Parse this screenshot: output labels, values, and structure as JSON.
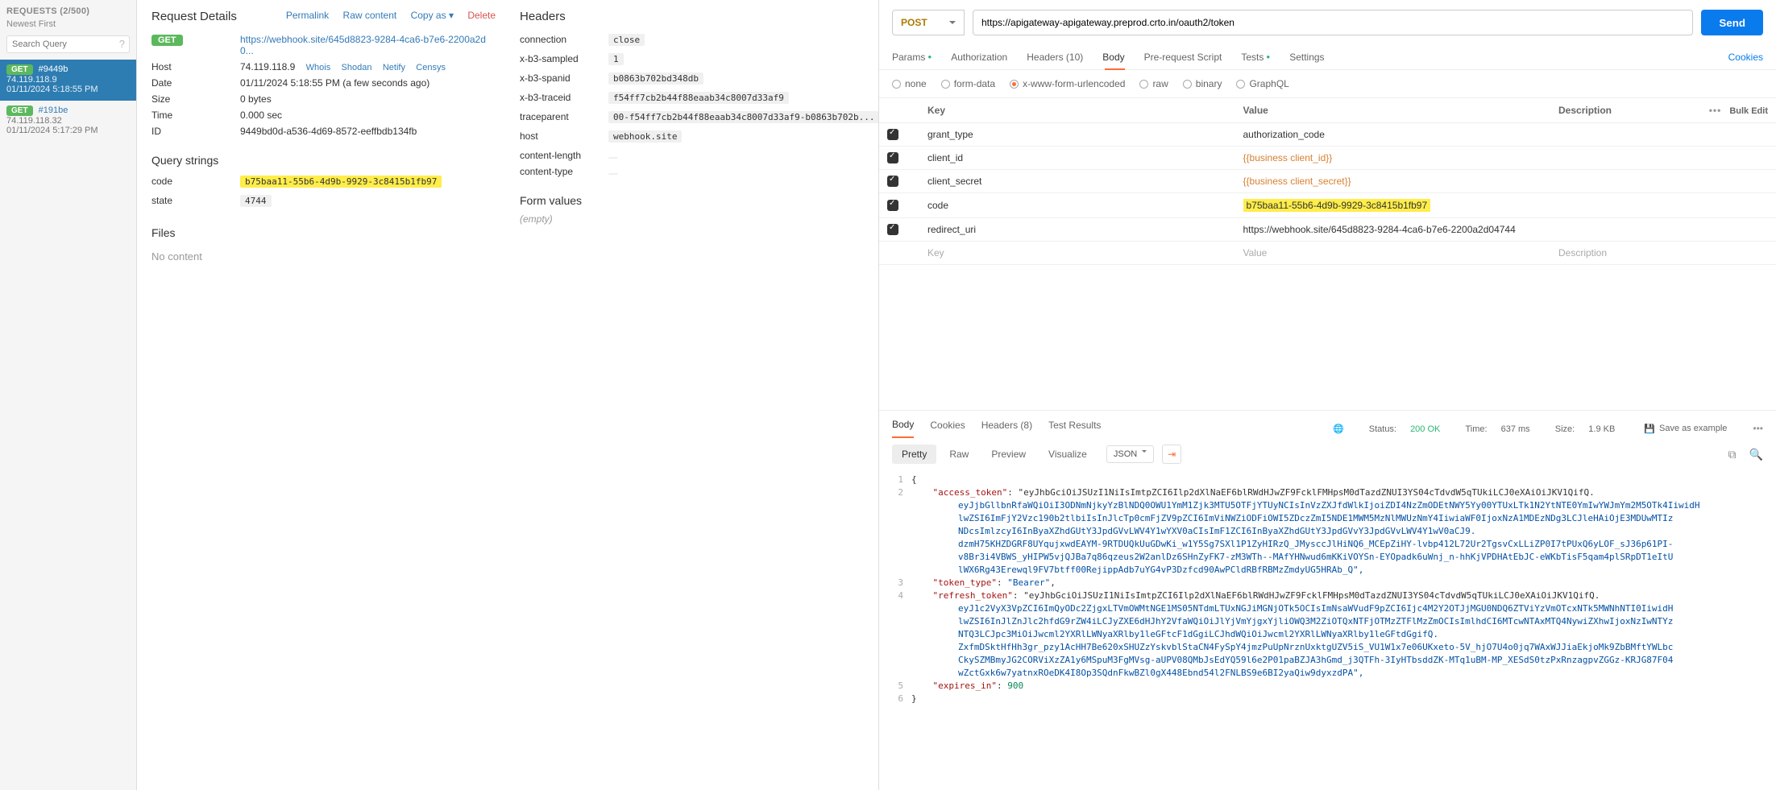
{
  "webhook": {
    "requests_header": "REQUESTS (2/500)",
    "newest_first": "Newest First",
    "search_placeholder": "Search Query",
    "items": [
      {
        "method": "GET",
        "id": "#9449b",
        "ip": "74.119.118.9",
        "time": "01/11/2024 5:18:55 PM"
      },
      {
        "method": "GET",
        "id": "#191be",
        "ip": "74.119.118.32",
        "time": "01/11/2024 5:17:29 PM"
      }
    ],
    "detail": {
      "title": "Request Details",
      "actions": {
        "permalink": "Permalink",
        "raw": "Raw content",
        "copyas": "Copy as",
        "delete": "Delete"
      },
      "method_badge": "GET",
      "url": "https://webhook.site/645d8823-9284-4ca6-b7e6-2200a2d0...",
      "host_label": "Host",
      "host": "74.119.118.9",
      "host_links": {
        "whois": "Whois",
        "shodan": "Shodan",
        "netify": "Netify",
        "censys": "Censys"
      },
      "date_label": "Date",
      "date": "01/11/2024 5:18:55 PM (a few seconds ago)",
      "size_label": "Size",
      "size": "0 bytes",
      "time_label": "Time",
      "time": "0.000 sec",
      "id_label": "ID",
      "id": "9449bd0d-a536-4d69-8572-eeffbdb134fb",
      "query_title": "Query strings",
      "query": [
        {
          "k": "code",
          "v": "b75baa11-55b6-4d9b-9929-3c8415b1fb97",
          "hl": true
        },
        {
          "k": "state",
          "v": "4744"
        }
      ],
      "files_title": "Files",
      "no_content": "No content"
    },
    "headers": {
      "title": "Headers",
      "rows": [
        {
          "k": "connection",
          "v": "close"
        },
        {
          "k": "x-b3-sampled",
          "v": "1"
        },
        {
          "k": "x-b3-spanid",
          "v": "b0863b702bd348db"
        },
        {
          "k": "x-b3-traceid",
          "v": "f54ff7cb2b44f88eaab34c8007d33af9"
        },
        {
          "k": "traceparent",
          "v": "00-f54ff7cb2b44f88eaab34c8007d33af9-b0863b702b..."
        },
        {
          "k": "host",
          "v": "webhook.site"
        },
        {
          "k": "content-length",
          "v": ""
        },
        {
          "k": "content-type",
          "v": ""
        }
      ],
      "form_title": "Form values",
      "form_empty": "(empty)"
    }
  },
  "postman": {
    "method": "POST",
    "url": "https://apigateway-apigateway.preprod.crto.in/oauth2/token",
    "send": "Send",
    "tabs": {
      "params": "Params",
      "auth": "Authorization",
      "headers": "Headers (10)",
      "body": "Body",
      "prereq": "Pre-request Script",
      "tests": "Tests",
      "settings": "Settings",
      "cookies": "Cookies"
    },
    "bodytype": {
      "none": "none",
      "formdata": "form-data",
      "xwww": "x-www-form-urlencoded",
      "raw": "raw",
      "binary": "binary",
      "graphql": "GraphQL"
    },
    "grid": {
      "hd_key": "Key",
      "hd_value": "Value",
      "hd_desc": "Description",
      "bulk": "Bulk Edit",
      "rows": [
        {
          "k": "grant_type",
          "v": "authorization_code",
          "var": false,
          "hl": false
        },
        {
          "k": "client_id",
          "v": "{{business client_id}}",
          "var": true,
          "hl": false
        },
        {
          "k": "client_secret",
          "v": "{{business client_secret}}",
          "var": true,
          "hl": false
        },
        {
          "k": "code",
          "v": "b75baa11-55b6-4d9b-9929-3c8415b1fb97",
          "var": false,
          "hl": true
        },
        {
          "k": "redirect_uri",
          "v": "https://webhook.site/645d8823-9284-4ca6-b7e6-2200a2d04744",
          "var": false,
          "hl": false
        }
      ],
      "ph_key": "Key",
      "ph_value": "Value",
      "ph_desc": "Description"
    },
    "response": {
      "tabs": {
        "body": "Body",
        "cookies": "Cookies",
        "headers": "Headers (8)",
        "tests": "Test Results"
      },
      "status_label": "Status:",
      "status": "200 OK",
      "time_label": "Time:",
      "time": "637 ms",
      "size_label": "Size:",
      "size": "1.9 KB",
      "save": "Save as example",
      "viewmodes": {
        "pretty": "Pretty",
        "raw": "Raw",
        "preview": "Preview",
        "visualize": "Visualize"
      },
      "format": "JSON",
      "json_lines": [
        "{",
        "    \"access_token\": \"eyJhbGciOiJSUzI1NiIsImtpZCI6Ilp2dXlNaEF6blRWdHJwZF9FcklFMHpsM0dTazdZNUI3YS04cTdvdW5qTUkiLCJ0eXAiOiJKV1QifQ.",
        "        eyJjbGllbnRfaWQiOiI3ODNmNjkyYzBlNDQ0OWU1YmM1Zjk3MTU5OTFjYTUyNCIsInVzZXJfdWlkIjoiZDI4NzZmODEtNWY5Yy00YTUxLTk1N2YtNTE0YmIwYWJmYm2M5OTk4IiwidH",
        "        lwZSI6ImFjY2Vzc190b2tlbiIsInJlcTp0cmFjZV9pZCI6ImViNWZiODFiOWI5ZDczZmI5NDE1MWM5MzNlMWUzNmY4IiwiaWF0IjoxNzA1MDEzNDg3LCJleHAiOjE3MDUwMTIz",
        "        NDcsImlzcyI6InByaXZhdGUtY3JpdGVvLWV4Y1wYXV0aCIsImF1ZCI6InByaXZhdGUtY3JpdGVvY3JpdGVvLWV4Y1wV0aCJ9.",
        "        dzmH75KHZDGRF8UYqujxwdEAYM-9RTDUQkUuGDwKi_w1Y5Sg7SXl1P1ZyHIRzQ_JMysccJlHiNQ6_MCEpZiHY-lvbp412L72Ur2TgsvCxLLiZP0I7tPUxQ6yLOF_sJ36p61PI-",
        "        v8Br3i4VBWS_yHIPW5vjQJBa7q86qzeus2W2anlDz6SHnZyFK7-zM3WTh--MAfYHNwud6mKKiVOYSn-EYOpadk6uWnj_n-hhKjVPDHAtEbJC-eWKbTisF5qam4plSRpDT1eItU",
        "        lWX6Rg43Erewql9FV7btff00RejippAdb7uYG4vP3Dzfcd90AwPCldRBfRBMzZmdyUG5HRAb_Q\",",
        "    \"token_type\": \"Bearer\",",
        "    \"refresh_token\": \"eyJhbGciOiJSUzI1NiIsImtpZCI6Ilp2dXlNaEF6blRWdHJwZF9FcklFMHpsM0dTazdZNUI3YS04cTdvdW5qTUkiLCJ0eXAiOiJKV1QifQ.",
        "        eyJ1c2VyX3VpZCI6ImQyODc2ZjgxLTVmOWMtNGE1MS05NTdmLTUxNGJiMGNjOTk5OCIsImNsaWVudF9pZCI6Ijc4M2Y2OTJjMGU0NDQ6ZTViYzVmOTcxNTk5MWNhNTI0IiwidH",
        "        lwZSI6InJlZnJlc2hfdG9rZW4iLCJyZXE6dHJhY2VfaWQiOiJlYjVmYjgxYjliOWQ3M2ZiOTQxNTFjOTMzZTFlMzZmOCIsImlhdCI6MTcwNTAxMTQ4NywiZXhwIjoxNzIwNTYz",
        "        NTQ3LCJpc3MiOiJwcml2YXRlLWNyaXRlby1leGFtcF1dGgiLCJhdWQiOiJwcml2YXRlLWNyaXRlby1leGFtdGgifQ.",
        "        ZxfmDSktHfHh3gr_pzy1AcHH7Be620xSHUZzYskvblStaCN4FySpY4jmzPuUpNrznUxktgUZV5iS_VU1W1x7e06UKxeto-5V_hjO7U4o0jq7WAxWJJiaEkjoMk9ZbBMftYWLbc",
        "        CkySZMBmyJG2CORViXzZA1y6MSpuM3FgMVsg-aUPV08QMbJsEdYQ59l6e2P01paBZJA3hGmd_j3QTFh-3IyHTbsddZK-MTq1uBM-MP_XESdS0tzPxRnzagpvZGGz-KRJG87F04",
        "        wZctGxk6w7yatnxROeDK4I8Op3SQdnFkwBZl0gX448Ebnd54l2FNLBS9e6BI2yaQiw9dyxzdPA\",",
        "    \"expires_in\": 900",
        "}"
      ],
      "line_numbers": [
        "1",
        "2",
        "",
        "",
        "",
        "",
        "",
        "",
        "3",
        "4",
        "",
        "",
        "",
        "",
        "",
        "",
        "5",
        "6"
      ]
    }
  }
}
